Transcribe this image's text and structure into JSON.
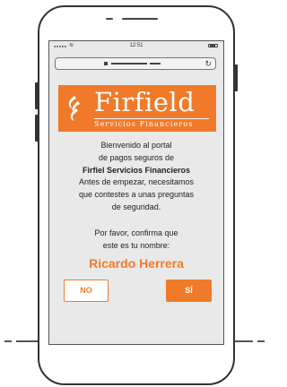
{
  "status_bar": {
    "time": "12:51"
  },
  "brand": {
    "name": "Firfield",
    "tagline": "Servicios Financieros",
    "color": "#f07a2a"
  },
  "intro": {
    "line1": "Bienvenido al portal",
    "line2": "de pagos seguros de",
    "company": "Firfiel Servicios Financieros"
  },
  "instructions": {
    "line1": "Antes de empezar, necesitamos",
    "line2": "que contestes a unas preguntas",
    "line3": "de seguridad."
  },
  "confirm": {
    "line1": "Por favor, confirma que",
    "line2": "este es tu nombre:"
  },
  "user_name": "Ricardo Herrera",
  "buttons": {
    "no_label": "NO",
    "yes_label": "SÍ"
  }
}
